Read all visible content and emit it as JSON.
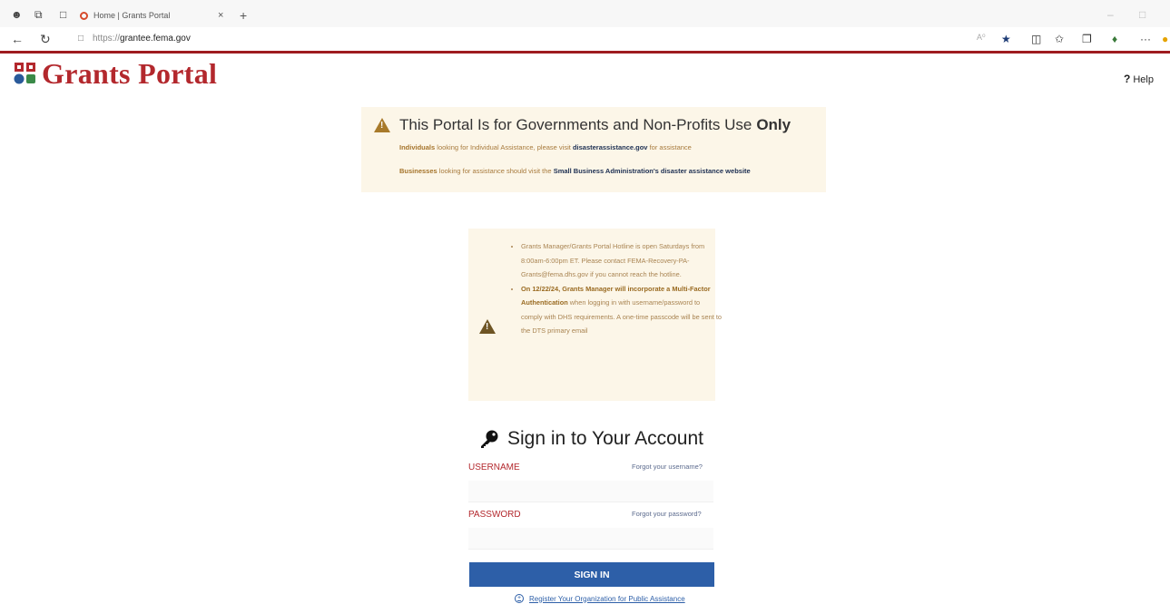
{
  "browser": {
    "tab_title": "Home | Grants Portal",
    "tab_close": "×",
    "new_tab": "+",
    "url_prefix": "https://",
    "url_host": "grantee.fema.gov",
    "more": "···"
  },
  "header": {
    "logo_text": "Grants Portal",
    "help_icon": "?",
    "help_label": "Help",
    "brand_color": "#b3282d"
  },
  "notice": {
    "heading": "This Portal Is for Governments and Non-Profits Use",
    "heading_emphasis": "Only",
    "line1": {
      "keyword": "Individuals",
      "text": " looking for Individual Assistance, please visit ",
      "link": "disasterassistance.gov",
      "after": " for assistance"
    },
    "line2": {
      "keyword": "Businesses",
      "text": " looking for assistance should visit the ",
      "link": "Small Business Administration's disaster assistance website"
    }
  },
  "alert": {
    "item1": "Grants Manager/Grants Portal Hotline is open Saturdays from 8:00am-6:00pm ET. Please contact FEMA-Recovery-PA-Grants@fema.dhs.gov if you cannot reach the hotline.",
    "item2_bold": "On 12/22/24, Grants Manager will incorporate a Multi-Factor Authentication",
    "item2_rest": " when logging in with username/password to comply with DHS requirements. A one-time passcode will be sent to the DTS primary email"
  },
  "signin": {
    "title": "Sign in to Your Account",
    "username_label": "USERNAME",
    "forgot_username": "Forgot your username?",
    "username_value": "",
    "password_label": "PASSWORD",
    "forgot_password": "Forgot your password?",
    "password_value": "",
    "button": "SIGN IN",
    "register": "Register Your Organization for Public Assistance"
  }
}
